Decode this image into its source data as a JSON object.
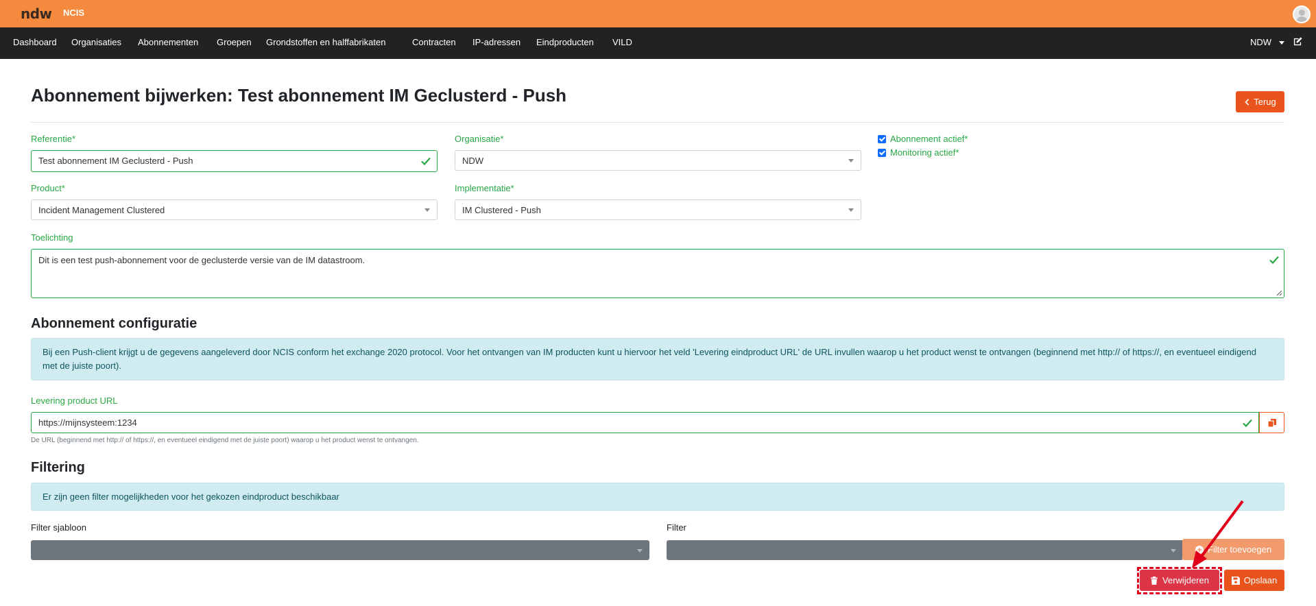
{
  "header": {
    "logo": "ndw",
    "app_name": "NCIS"
  },
  "nav": {
    "items": [
      "Dashboard",
      "Organisaties",
      "Abonnementen",
      "Groepen",
      "Grondstoffen en halffabrikaten",
      "Contracten",
      "IP-adressen",
      "Eindproducten",
      "VILD"
    ],
    "user": "NDW"
  },
  "page": {
    "title": "Abonnement bijwerken: Test abonnement IM Geclusterd - Push",
    "back_label": "Terug"
  },
  "form": {
    "referentie_label": "Referentie*",
    "referentie_value": "Test abonnement IM Geclusterd - Push",
    "organisatie_label": "Organisatie*",
    "organisatie_value": "NDW",
    "abonnement_actief_label": "Abonnement actief*",
    "monitoring_actief_label": "Monitoring actief*",
    "product_label": "Product*",
    "product_value": "Incident Management Clustered",
    "implementatie_label": "Implementatie*",
    "implementatie_value": "IM Clustered - Push",
    "toelichting_label": "Toelichting",
    "toelichting_value": "Dit is een test push-abonnement voor de geclusterde versie van de IM datastroom."
  },
  "config": {
    "heading": "Abonnement configuratie",
    "info": "Bij een Push-client krijgt u de gegevens aangeleverd door NCIS conform het exchange 2020 protocol. Voor het ontvangen van IM producten kunt u hiervoor het veld 'Levering eindproduct URL' de URL invullen waarop u het product wenst te ontvangen (beginnend met http:// of https://, en eventueel eindigend met de juiste poort).",
    "url_label": "Levering product URL",
    "url_value": "https://mijnsysteem:1234",
    "url_help": "De URL (beginnend met http:// of https://, en eventueel eindigend met de juiste poort) waarop u het product wenst te ontvangen."
  },
  "filtering": {
    "heading": "Filtering",
    "info": "Er zijn geen filter mogelijkheden voor het gekozen eindproduct beschikbaar",
    "template_label": "Filter sjabloon",
    "filter_label": "Filter",
    "add_label": "Filter toevoegen"
  },
  "actions": {
    "delete_label": "Verwijderen",
    "save_label": "Opslaan"
  },
  "colors": {
    "brand_orange": "#f58a3e",
    "accent": "#e8541c",
    "valid": "#28a745",
    "danger": "#dc3545"
  }
}
